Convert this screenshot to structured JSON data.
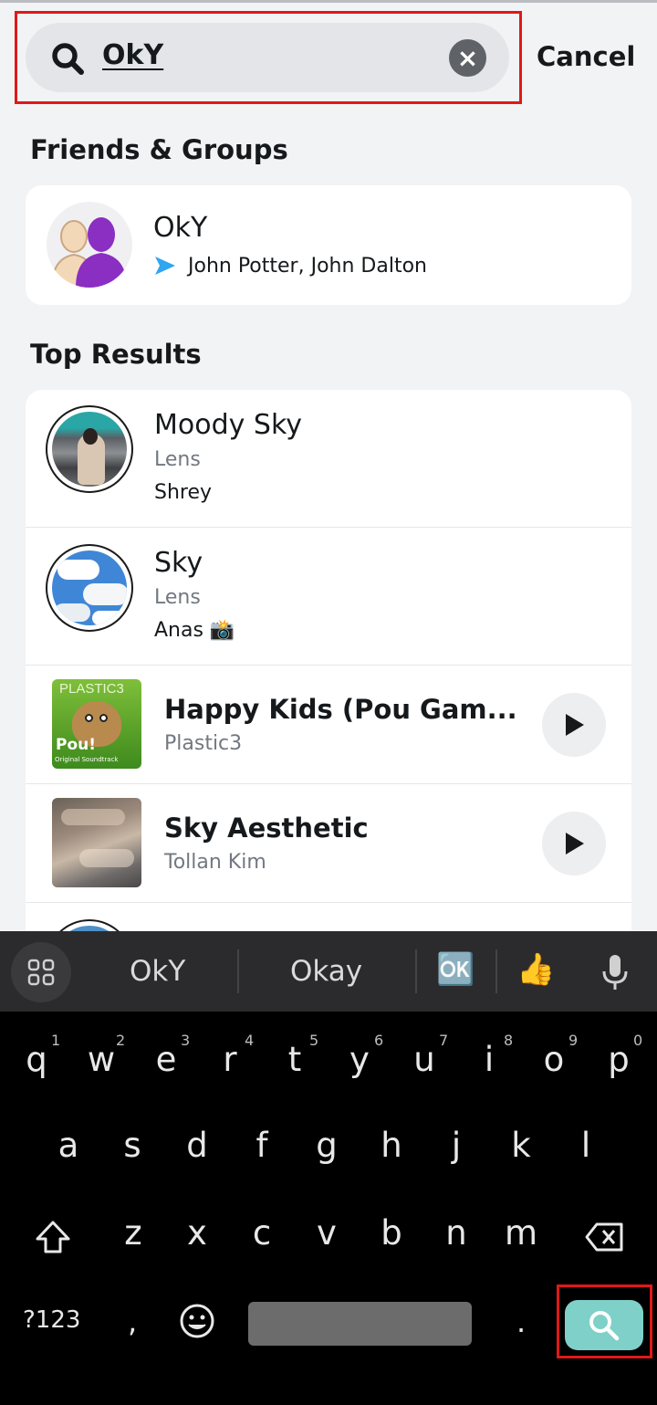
{
  "search": {
    "query": "OkY",
    "cancel_label": "Cancel"
  },
  "friends_section": {
    "title": "Friends & Groups",
    "group": {
      "name": "OkY",
      "members": "John Potter, John Dalton"
    }
  },
  "top_results_section": {
    "title": "Top Results",
    "items": [
      {
        "name": "Moody Sky",
        "type": "Lens",
        "creator": "Shrey"
      },
      {
        "name": "Sky",
        "type": "Lens",
        "creator": "Anas 📸"
      },
      {
        "name": "Happy Kids (Pou Gam...",
        "artist": "Plastic3",
        "thumb_label": "PLASTIC3",
        "thumb_logo": "Pou!",
        "thumb_caption": "Original Soundtrack"
      },
      {
        "name": "Sky Aesthetic",
        "artist": "Tollan Kim"
      }
    ]
  },
  "keyboard": {
    "suggestions": [
      "OkY",
      "Okay"
    ],
    "suggestion_emoji": [
      "🆗",
      "👍"
    ],
    "row1": [
      {
        "k": "q",
        "n": "1"
      },
      {
        "k": "w",
        "n": "2"
      },
      {
        "k": "e",
        "n": "3"
      },
      {
        "k": "r",
        "n": "4"
      },
      {
        "k": "t",
        "n": "5"
      },
      {
        "k": "y",
        "n": "6"
      },
      {
        "k": "u",
        "n": "7"
      },
      {
        "k": "i",
        "n": "8"
      },
      {
        "k": "o",
        "n": "9"
      },
      {
        "k": "p",
        "n": "0"
      }
    ],
    "row2": [
      "a",
      "s",
      "d",
      "f",
      "g",
      "h",
      "j",
      "k",
      "l"
    ],
    "row3": [
      "z",
      "x",
      "c",
      "v",
      "b",
      "n",
      "m"
    ],
    "numbers_key": "?123",
    "comma_key": ",",
    "period_key": "."
  },
  "colors": {
    "highlight": "#e01818",
    "play_accent": "#16191c",
    "search_key": "#7fd0c8",
    "bitmoji_arrow": "#2fa6ee"
  }
}
